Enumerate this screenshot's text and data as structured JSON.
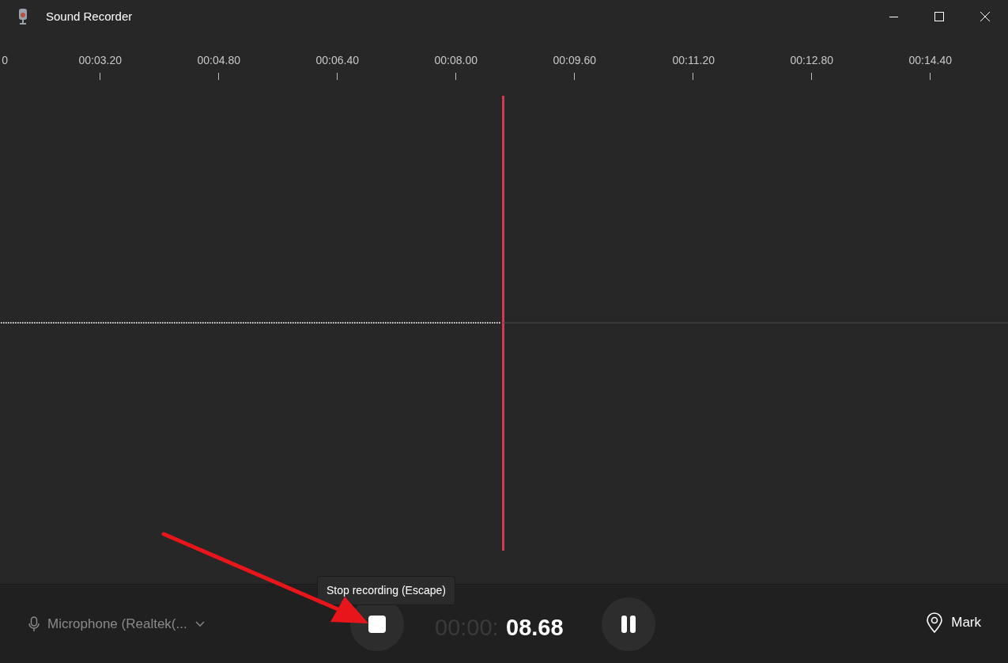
{
  "window": {
    "title": "Sound Recorder"
  },
  "timeline": {
    "labels": [
      "0",
      "00:03.20",
      "00:04.80",
      "00:06.40",
      "00:08.00",
      "00:09.60",
      "00:11.20",
      "00:12.80",
      "00:14.40"
    ]
  },
  "controls": {
    "microphone": "Microphone (Realtek(...",
    "tooltip": "Stop recording (Escape)",
    "timer_elapsed": "00:00:",
    "timer_current": "08.68",
    "mark": "Mark"
  }
}
